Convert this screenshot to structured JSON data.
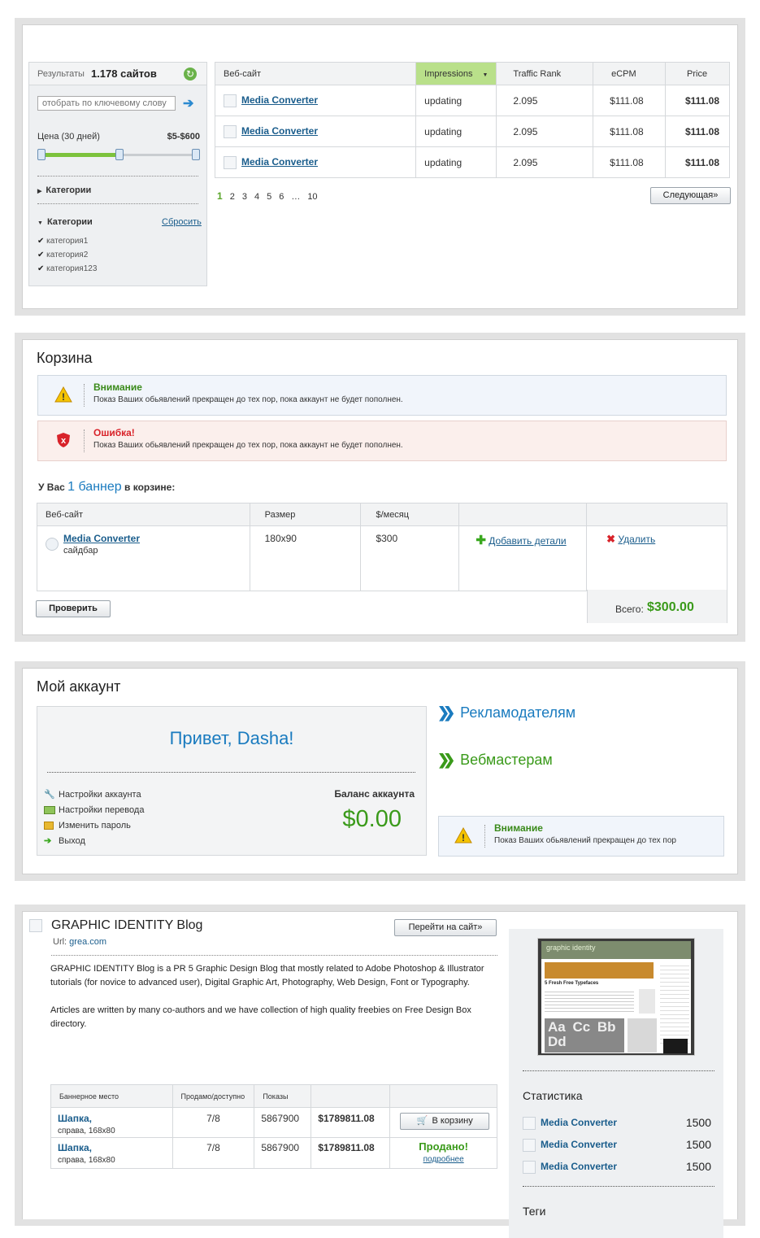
{
  "results": {
    "label": "Результаты",
    "count": "1.178 сайтов",
    "keyword_placeholder": "отобрать по ключевому слову",
    "price_label": "Цена (30 дней)",
    "price_range": "$5-$600",
    "categories_collapsed": "Категории",
    "categories_expanded": "Категории",
    "reset": "Сбросить",
    "category_items": [
      "категория1",
      "категория2",
      "категория123"
    ],
    "columns": [
      "Веб-сайт",
      "Impressions",
      "Traffic Rank",
      "eCPM",
      "Price"
    ],
    "rows": [
      {
        "site": "Media Converter",
        "impressions": "updating",
        "rank": "2.095",
        "ecpm": "$111.08",
        "price": "$111.08"
      },
      {
        "site": "Media Converter",
        "impressions": "updating",
        "rank": "2.095",
        "ecpm": "$111.08",
        "price": "$111.08"
      },
      {
        "site": "Media Converter",
        "impressions": "updating",
        "rank": "2.095",
        "ecpm": "$111.08",
        "price": "$111.08"
      }
    ],
    "pages": [
      "1",
      "2",
      "3",
      "4",
      "5",
      "6",
      "…",
      "10"
    ],
    "next": "Следующая»"
  },
  "cart": {
    "title": "Корзина",
    "warning_title": "Внимание",
    "warning_text": "Показ Ваших обьявлений прекращен до тех пор, пока аккаунт не будет пополнен.",
    "error_title": "Ошибка!",
    "error_text": "Показ Ваших обьявлений прекращен до тех пор, пока аккаунт не будет пополнен.",
    "summary_pre": "У Вас",
    "summary_count": "1 баннер",
    "summary_post": "в корзине:",
    "columns": [
      "Веб-сайт",
      "Размер",
      "$/месяц",
      "",
      ""
    ],
    "item": {
      "site": "Media Converter",
      "placement": "сайдбар",
      "size": "180x90",
      "price": "$300",
      "add": "Добавить детали",
      "delete": "Удалить"
    },
    "check": "Проверить",
    "total_label": "Всего:",
    "total_value": "$300.00"
  },
  "account": {
    "title": "Мой аккаунт",
    "greeting": "Привет, Dasha!",
    "links": [
      "Настройки аккаунта",
      "Настройки перевода",
      "Изменить пароль",
      "Выход"
    ],
    "balance_label": "Баланс аккаунта",
    "balance_value": "$0.00",
    "advertisers": "Рекламодателям",
    "webmasters": "Вебмастерам",
    "warning_title": "Внимание",
    "warning_text": "Показ Ваших обьявлений прекращен до тех пор"
  },
  "blog": {
    "title": "GRAPHIC IDENTITY Blog",
    "url_label": "Url:",
    "url": "grea.com",
    "visit": "Перейти на сайт»",
    "desc1": "GRAPHIC IDENTITY Blog is a PR 5 Graphic Design Blog that mostly related to Adobe Photoshop & Illustrator tutorials (for novice to advanced user), Digital Graphic Art, Photography, Web Design, Font or Typography.",
    "desc2": "Articles are written by many co-authors and we have collection of high quality freebies on Free Design Box directory.",
    "columns": [
      "Баннерное место",
      "Продамо/доступно",
      "Показы",
      "",
      ""
    ],
    "rows": [
      {
        "place": "Шапка,",
        "sub": "справа, 168x80",
        "avail": "7/8",
        "shows": "5867900",
        "price": "$1789811.08",
        "action": "В корзину"
      },
      {
        "place": "Шапка,",
        "sub": "справа, 168x80",
        "avail": "7/8",
        "shows": "5867900",
        "price": "$1789811.08",
        "sold": "Продано!",
        "more": "подробнее"
      }
    ],
    "stats_title": "Статистика",
    "stats": [
      {
        "name": "Media Converter",
        "value": "1500"
      },
      {
        "name": "Media Converter",
        "value": "1500"
      },
      {
        "name": "Media Converter",
        "value": "1500"
      }
    ],
    "tags_title": "Теги",
    "thumb": {
      "header": "graphic identity",
      "headline": "5 Fresh Free Typefaces",
      "glyphs": "Aa Cc Bb Dd"
    }
  },
  "colors": {
    "link": "#1a5d8c",
    "money": "#3a9a1a",
    "highlight": "#b9e08a",
    "warning_bg": "#f1f5fb",
    "error_bg": "#fbefec"
  }
}
